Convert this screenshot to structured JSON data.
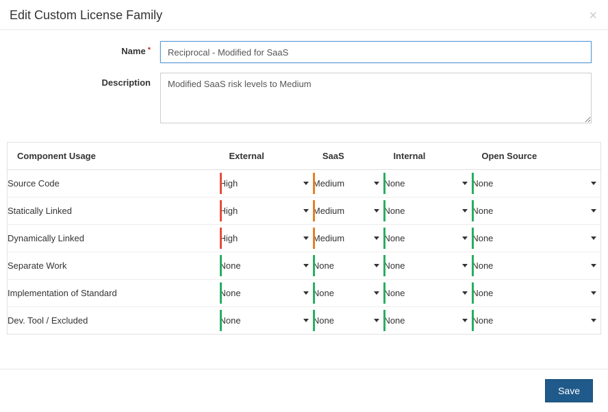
{
  "header": {
    "title": "Edit Custom License Family",
    "close_glyph": "×"
  },
  "form": {
    "name_label": "Name",
    "name_value": "Reciprocal - Modified for SaaS",
    "desc_label": "Description",
    "desc_value": "Modified SaaS risk levels to Medium"
  },
  "table": {
    "col_usage": "Component Usage",
    "cols": [
      "External",
      "SaaS",
      "Internal",
      "Open Source"
    ],
    "rows": [
      {
        "usage": "Source Code",
        "risks": [
          "High",
          "Medium",
          "None",
          "None"
        ]
      },
      {
        "usage": "Statically Linked",
        "risks": [
          "High",
          "Medium",
          "None",
          "None"
        ]
      },
      {
        "usage": "Dynamically Linked",
        "risks": [
          "High",
          "Medium",
          "None",
          "None"
        ]
      },
      {
        "usage": "Separate Work",
        "risks": [
          "None",
          "None",
          "None",
          "None"
        ]
      },
      {
        "usage": "Implementation of Standard",
        "risks": [
          "None",
          "None",
          "None",
          "None"
        ]
      },
      {
        "usage": "Dev. Tool / Excluded",
        "risks": [
          "None",
          "None",
          "None",
          "None"
        ]
      }
    ]
  },
  "footer": {
    "save_label": "Save"
  },
  "risk_colors": {
    "High": "bar-high",
    "Medium": "bar-medium",
    "Low": "bar-medium",
    "None": "bar-none"
  }
}
